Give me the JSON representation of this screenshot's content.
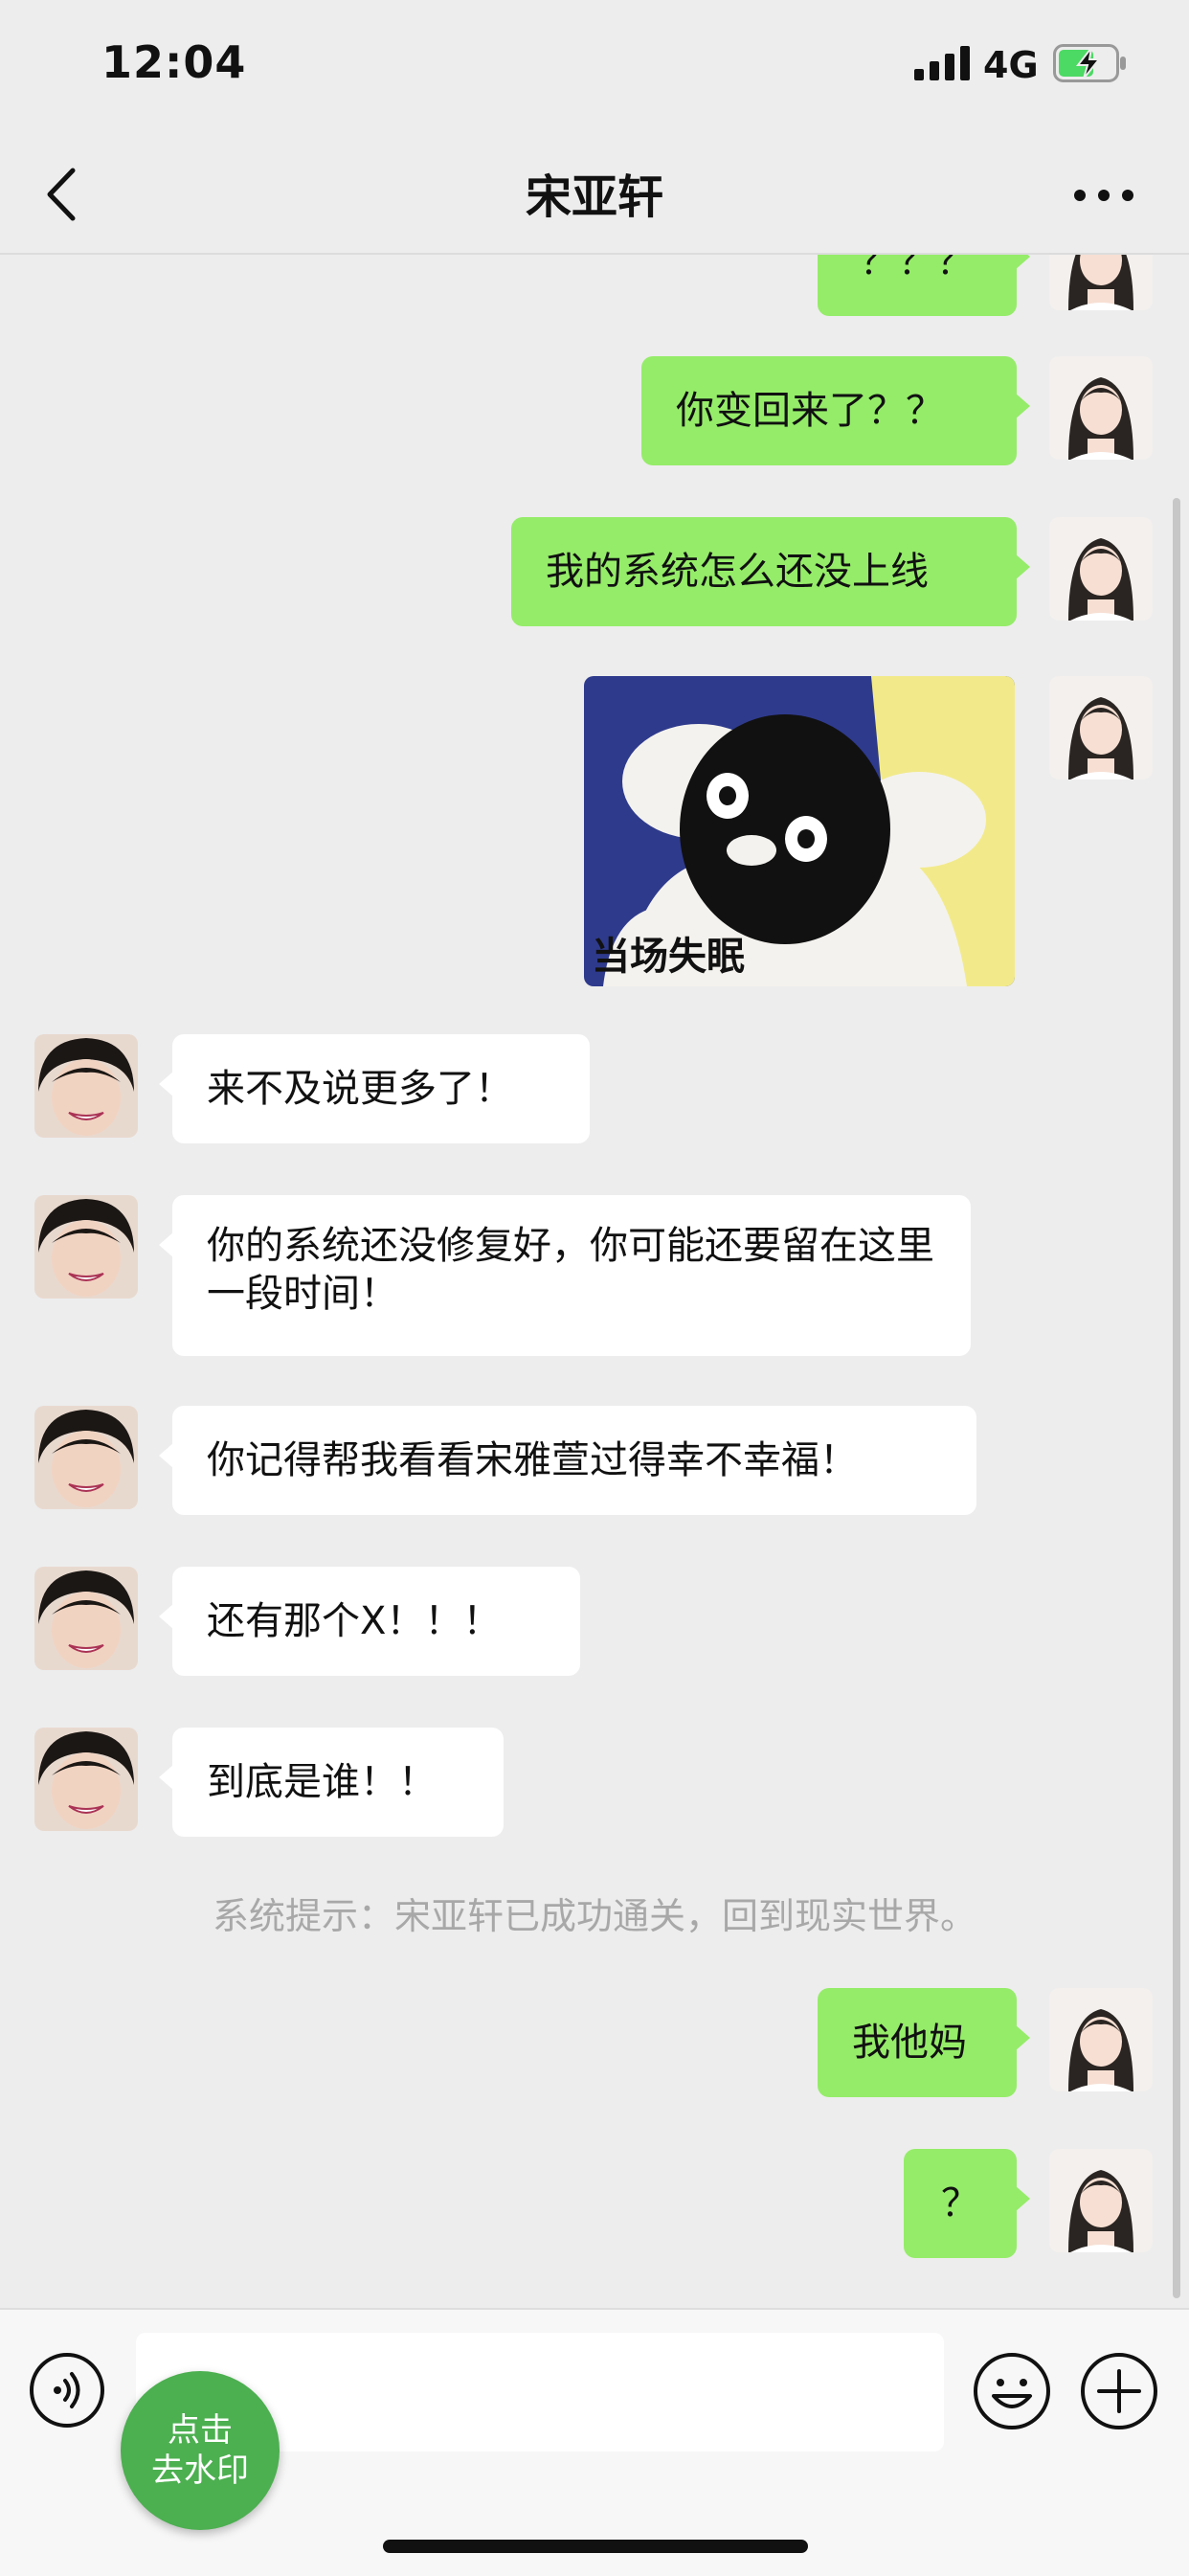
{
  "status_bar": {
    "time": "12:04",
    "network": "4G",
    "battery_color": "#4cd964"
  },
  "nav": {
    "title": "宋亚轩",
    "back_icon": "chevron-left-icon",
    "more_icon": "more-dots-icon"
  },
  "messages": [
    {
      "direction": "out",
      "text": "？？？"
    },
    {
      "direction": "out",
      "text": "你变回来了？？"
    },
    {
      "direction": "out",
      "text": "我的系统怎么还没上线"
    },
    {
      "direction": "out",
      "type": "sticker",
      "caption": "当场失眠"
    },
    {
      "direction": "in",
      "text": "来不及说更多了！"
    },
    {
      "direction": "in",
      "text": "你的系统还没修复好，你可能还要留在这里一段时间！"
    },
    {
      "direction": "in",
      "text": "你记得帮我看看宋雅萱过得幸不幸福！"
    },
    {
      "direction": "in",
      "text": "还有那个X！！！"
    },
    {
      "direction": "in",
      "text": "到底是谁！！"
    },
    {
      "type": "system",
      "text": "系统提示：宋亚轩已成功通关，回到现实世界。"
    },
    {
      "direction": "out",
      "text": "我他妈"
    },
    {
      "direction": "out",
      "text": "？"
    }
  ],
  "input_bar": {
    "value": "",
    "watermark_button": {
      "line1": "点击",
      "line2": "去水印"
    }
  },
  "colors": {
    "outgoing_bubble": "#95ec69",
    "incoming_bubble": "#ffffff",
    "background": "#ededed",
    "watermark_button": "#4caf50"
  }
}
